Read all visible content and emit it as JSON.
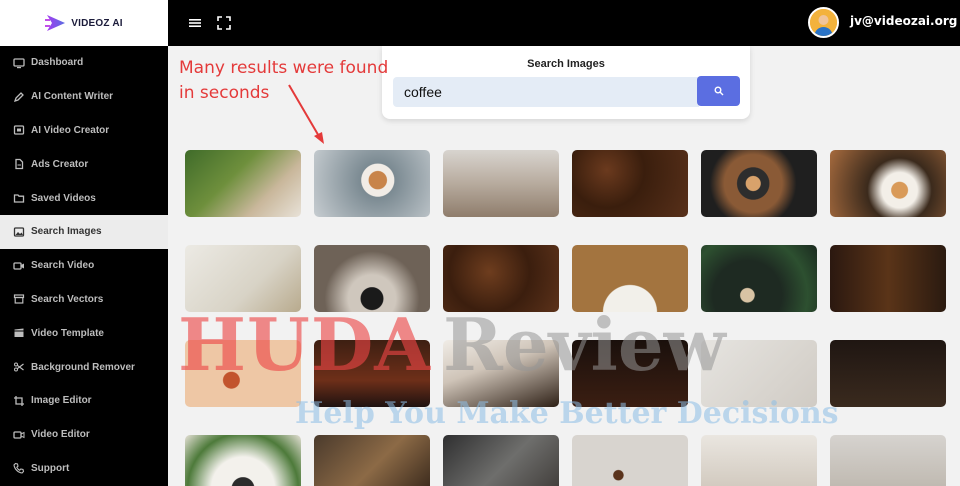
{
  "app": {
    "logo_text": "VIDEOZ AI"
  },
  "sidebar": {
    "items": [
      {
        "label": "Dashboard",
        "icon": "monitor-icon",
        "active": false
      },
      {
        "label": "AI Content Writer",
        "icon": "pen-icon",
        "active": false
      },
      {
        "label": "AI Video Creator",
        "icon": "film-icon",
        "active": false
      },
      {
        "label": "Ads Creator",
        "icon": "document-icon",
        "active": false
      },
      {
        "label": "Saved Videos",
        "icon": "folder-icon",
        "active": false
      },
      {
        "label": "Search Images",
        "icon": "image-icon",
        "active": true
      },
      {
        "label": "Search Video",
        "icon": "video-icon",
        "active": false
      },
      {
        "label": "Search Vectors",
        "icon": "archive-icon",
        "active": false
      },
      {
        "label": "Video Template",
        "icon": "clapper-icon",
        "active": false
      },
      {
        "label": "Background Remover",
        "icon": "scissors-icon",
        "active": false
      },
      {
        "label": "Image Editor",
        "icon": "crop-icon",
        "active": false
      },
      {
        "label": "Video Editor",
        "icon": "video-edit-icon",
        "active": false
      },
      {
        "label": "Support",
        "icon": "phone-icon",
        "active": false
      }
    ]
  },
  "topbar": {
    "user_email": "jv@videozai.org"
  },
  "search": {
    "title": "Search Images",
    "query": "coffee"
  },
  "annotation": {
    "line1": "Many results were found",
    "line2": "in seconds"
  },
  "watermark": {
    "brand_a": "HUDA",
    "brand_b": "Review",
    "tagline": "Help You Make Better Decisions"
  },
  "colors": {
    "accent": "#5b6ee1",
    "annotation": "#e43a3a",
    "sidebar_bg": "#000000"
  }
}
